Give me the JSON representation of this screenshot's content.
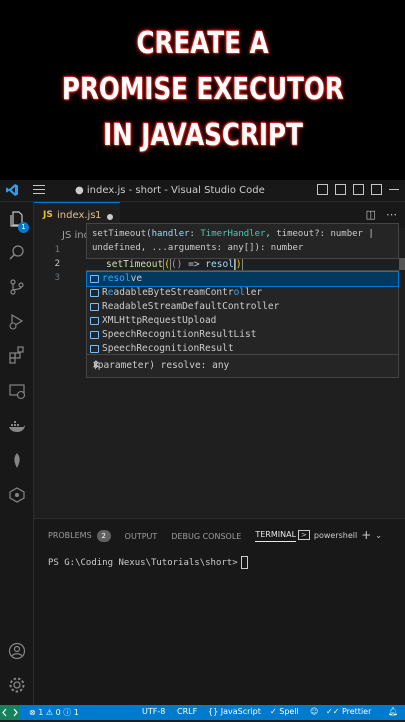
{
  "banner": {
    "line1": "CREATE A",
    "line2": "PROMISE EXECUTOR",
    "line3": "IN JAVASCRIPT"
  },
  "titlebar": {
    "title": "● index.js - short - Visual Studio Code"
  },
  "activity_bar": {
    "explorer_badge": "1",
    "icons": [
      "explorer-icon",
      "search-icon",
      "source-control-icon",
      "run-debug-icon",
      "extensions-icon",
      "remote-explorer-icon",
      "docker-icon",
      "mongodb-icon",
      "gitlens-icon",
      "account-icon",
      "settings-gear-icon"
    ]
  },
  "tab": {
    "lang": "JS",
    "name": "index.js",
    "problems": "1"
  },
  "editor": {
    "breadcrumb": "JS index.js",
    "line_numbers": [
      "1",
      "2",
      "3"
    ],
    "code_fn": "setTimeout",
    "code_arrow": " => ",
    "code_typed": "resol"
  },
  "signature_help": {
    "line1_a": "setTimeout(",
    "line1_p": "handler",
    "line1_sep": ": ",
    "line1_t": "TimerHandler",
    "line1_rest": ", timeout?: number |",
    "line2": "undefined, ...arguments: any[]): number"
  },
  "suggestions": {
    "items": [
      {
        "match": "resol",
        "rest": "ve"
      },
      {
        "pre": "R",
        "m1": "e",
        "mid": "adableByteStreamContr",
        "m2": "ol",
        "end": "ler"
      },
      {
        "full": "ReadableStreamDefaultController"
      },
      {
        "full": "XMLHttpRequestUpload"
      },
      {
        "full": "SpeechRecognitionResultList"
      },
      {
        "full": "SpeechRecognitionResult"
      }
    ],
    "detail": "(parameter) resolve: any",
    "close": "✕"
  },
  "panel": {
    "tabs": [
      "PROBLEMS",
      "OUTPUT",
      "DEBUG CONSOLE",
      "TERMINAL"
    ],
    "problems_count": "2",
    "shell": "powershell",
    "prompt": "PS G:\\Coding Nexus\\Tutorials\\short>"
  },
  "statusbar": {
    "problems": "⊗ 1 ⚠ 0 ⓘ 1",
    "encoding": "UTF-8",
    "eol": "CRLF",
    "language": "{} JavaScript",
    "spell": "✓ Spell",
    "prettier": "✓✓ Prettier"
  },
  "colors": {
    "accent": "#007acc",
    "banner_glow": "#e0302a",
    "editor_bg": "#1f1f1f"
  }
}
